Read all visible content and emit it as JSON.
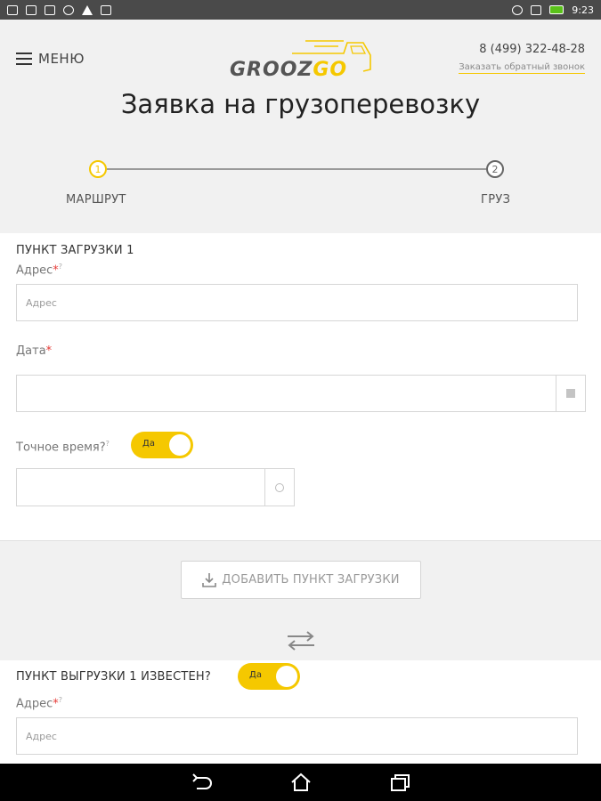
{
  "statusbar": {
    "time": "9:23"
  },
  "header": {
    "menu_label": "МЕНЮ",
    "logo_part1": "GROOZ",
    "logo_part2": "GO",
    "phone": "8 (499) 322-48-28",
    "callback": "Заказать обратный звонок",
    "title": "Заявка на грузоперевозку"
  },
  "steps": [
    {
      "number": "1",
      "label": "МАРШРУТ"
    },
    {
      "number": "2",
      "label": "ГРУЗ"
    }
  ],
  "loading": {
    "title": "ПУНКТ ЗАГРУЗКИ 1",
    "address_label": "Адрес",
    "address_placeholder": "Адрес",
    "date_label": "Дата",
    "exact_time_label": "Точное время?",
    "toggle_label": "Да",
    "add_button": "ДОБАВИТЬ ПУНКТ ЗАГРУЗКИ"
  },
  "unloading": {
    "title": "ПУНКТ ВЫГРУЗКИ 1 ИЗВЕСТЕН?",
    "toggle_label": "Да",
    "address_label": "Адрес",
    "address_placeholder": "Адрес"
  },
  "colors": {
    "accent": "#f5c800",
    "required": "#e53935"
  }
}
